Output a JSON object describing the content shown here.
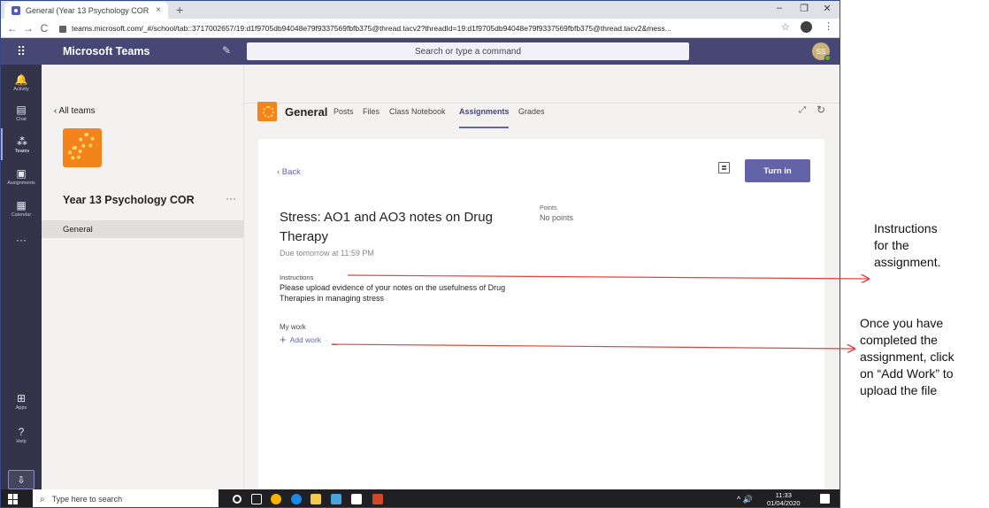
{
  "browser": {
    "tab_title": "General (Year 13 Psychology COR",
    "tab_close": "×",
    "new_tab": "+",
    "url": "teams.microsoft.com/_#/school/tab::3717002657/19:d1f9705db94048e79f9337569fbfb375@thread.tacv2?threadId=19:d1f9705db94048e79f9337569fbfb375@thread.tacv2&mess...",
    "minimize": "–",
    "restore": "❐",
    "close": "✕",
    "back": "←",
    "forward": "→",
    "reload": "C",
    "bookmark": "☆",
    "menu": "⋮"
  },
  "teams_bar": {
    "app_title": "Microsoft Teams",
    "search_placeholder": "Search or type a command",
    "avatar_initials": "SS"
  },
  "rail": {
    "items": [
      {
        "label": "Activity",
        "icon": "bell-icon",
        "glyph": "🔔"
      },
      {
        "label": "Chat",
        "icon": "chat-icon",
        "glyph": "▤"
      },
      {
        "label": "Teams",
        "icon": "teams-icon",
        "glyph": "⁂"
      },
      {
        "label": "Assignments",
        "icon": "assignments-icon",
        "glyph": "▣"
      },
      {
        "label": "Calendar",
        "icon": "calendar-icon",
        "glyph": "▦"
      },
      {
        "label": "",
        "icon": "more-icon",
        "glyph": "···"
      },
      {
        "label": "Apps",
        "icon": "apps-icon",
        "glyph": "⊞"
      },
      {
        "label": "Help",
        "icon": "help-icon",
        "glyph": "?"
      }
    ],
    "download_glyph": "⇩"
  },
  "team_panel": {
    "back_label": "‹  All teams",
    "team_name": "Year 13 Psychology COR",
    "more": "···",
    "channel": "General"
  },
  "channel": {
    "name": "General",
    "tabs": [
      "Posts",
      "Files",
      "Class Notebook",
      "Assignments",
      "Grades"
    ],
    "active_tab": "Assignments",
    "expand_glyph": "⤢",
    "refresh_glyph": "↻"
  },
  "assignment": {
    "back": "‹  Back",
    "turn_in": "Turn in",
    "title": "Stress: AO1 and AO3 notes on Drug Therapy",
    "points_label": "Points",
    "points_value": "No points",
    "due": "Due tomorrow at 11:59 PM",
    "instructions_label": "Instructions",
    "instructions_text": "Please upload evidence of your notes on the usefulness of Drug Therapies in managing stress",
    "my_work_label": "My work",
    "add_work": "Add work",
    "add_glyph": "+"
  },
  "taskbar": {
    "search_placeholder": "Type here to search",
    "search_glyph": "⌕",
    "tray_glyphs": "^  🔊",
    "time": "11:33",
    "date": "01/04/2020"
  },
  "annotations": {
    "instructions_note": [
      "Instructions",
      "for the",
      "assignment."
    ],
    "addwork_note": [
      "Once you have",
      "completed the",
      "assignment, click",
      "on “Add Work” to",
      "upload the file"
    ]
  },
  "colors": {
    "teams_purple": "#464775",
    "accent": "#6264a7",
    "rail": "#33344a",
    "team_orange": "#f2841b",
    "arrow_red": "#e8413c"
  }
}
